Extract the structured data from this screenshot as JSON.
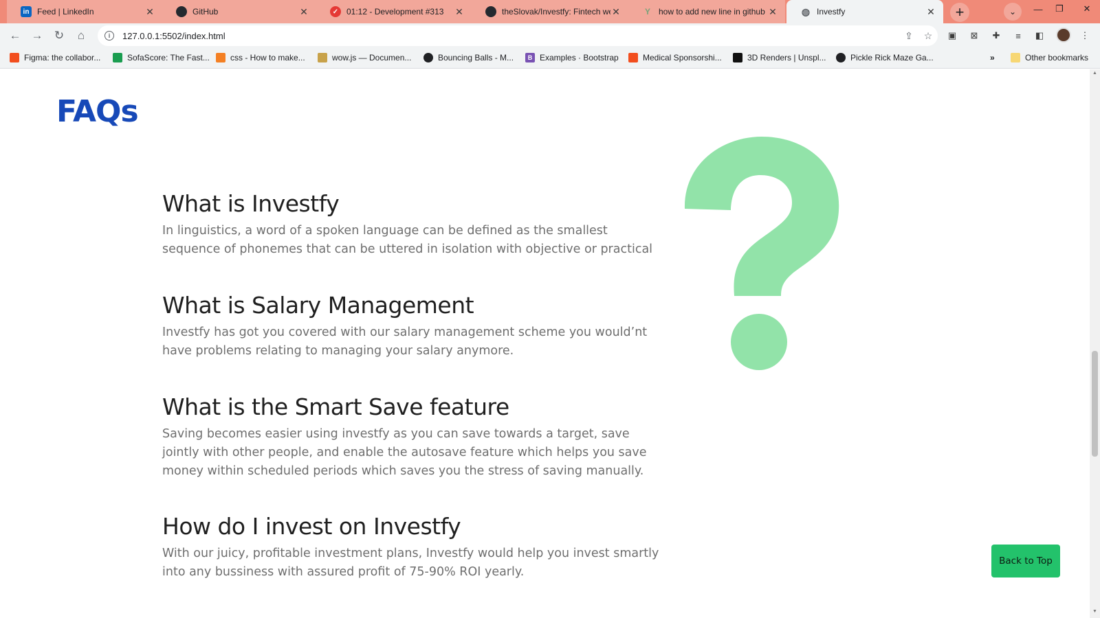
{
  "browser": {
    "tabs": [
      {
        "title": "Feed | LinkedIn",
        "icon": "linkedin-icon",
        "icon_glyph": "in",
        "icon_color": "#0a66c2"
      },
      {
        "title": "GitHub",
        "icon": "github-icon",
        "icon_glyph": "●",
        "icon_color": "#24292f"
      },
      {
        "title": "01:12 - Development #313",
        "icon": "status-check-icon",
        "icon_glyph": "✓",
        "icon_color": "#e53935"
      },
      {
        "title": "theSlovak/Investfy: Fintech web",
        "icon": "github-icon",
        "icon_glyph": "●",
        "icon_color": "#24292f"
      },
      {
        "title": "how to add new line in github",
        "icon": "gitter-icon",
        "icon_glyph": "Y",
        "icon_color": "#7aa37a"
      },
      {
        "title": "Investfy",
        "icon": "globe-icon",
        "icon_glyph": "◍",
        "icon_color": "#5f6368"
      }
    ],
    "active_tab_index": 5,
    "url": "127.0.0.1:5502/index.html",
    "bookmarks": [
      {
        "label": "Figma: the collabor...",
        "icon": "figma-icon",
        "icon_color": "#f24e1e"
      },
      {
        "label": "SofaScore: The Fast...",
        "icon": "sofascore-icon",
        "icon_color": "#1a9d50"
      },
      {
        "label": "css - How to make...",
        "icon": "stackoverflow-icon",
        "icon_color": "#f48024"
      },
      {
        "label": "wow.js — Documen...",
        "icon": "doge-icon",
        "icon_color": "#c8a24a"
      },
      {
        "label": "Bouncing Balls - M...",
        "icon": "codepen-icon",
        "icon_color": "#202124"
      },
      {
        "label": "Examples · Bootstrap",
        "icon": "bootstrap-icon",
        "icon_color": "#7952b3"
      },
      {
        "label": "Medical Sponsorshi...",
        "icon": "figma-icon",
        "icon_color": "#f24e1e"
      },
      {
        "label": "3D Renders | Unspl...",
        "icon": "unsplash-icon",
        "icon_color": "#111111"
      },
      {
        "label": "Pickle Rick Maze Ga...",
        "icon": "codepen-icon",
        "icon_color": "#202124"
      }
    ],
    "more_bookmarks": "»",
    "other_bookmarks": "Other bookmarks"
  },
  "page": {
    "heading": "FAQs",
    "faqs": [
      {
        "question": "What is Investfy",
        "answer": "In linguistics, a word of a spoken language can be defined as the smallest sequence of phonemes that can be uttered in isolation with objective or practical"
      },
      {
        "question": "What is Salary Management",
        "answer": "Investfy has got you covered with our salary management scheme you would’nt have problems relating to managing your salary anymore."
      },
      {
        "question": "What is the Smart Save feature",
        "answer": "Saving becomes easier using investfy as you can save towards a target, save jointly with other people, and enable the autosave feature which helps you save money within scheduled periods which saves you the stress of saving manually."
      },
      {
        "question": "How do I invest on Investfy",
        "answer": "With our juicy, profitable investment plans, Investfy would help you invest smartly into any bussiness with assured profit of 75-90% ROI yearly."
      }
    ],
    "back_to_top": "Back to Top",
    "colors": {
      "heading": "#1749b8",
      "question_mark": "#92e3a9",
      "button": "#23c26b"
    }
  }
}
